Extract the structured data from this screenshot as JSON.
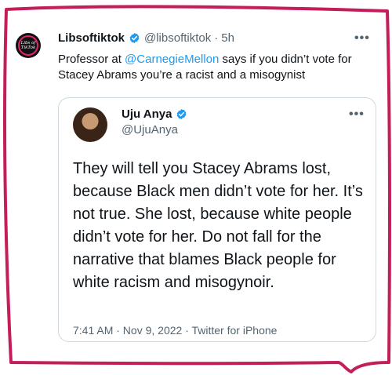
{
  "tweet": {
    "display_name": "Libsoftiktok",
    "handle": "@libsoftiktok",
    "separator": "·",
    "time": "5h",
    "more": "•••",
    "avatar_text": "Libs of TikTok",
    "text_before": "Professor at ",
    "mention": "@CarnegieMellon",
    "text_after": " says if you didn’t vote for Stacey Abrams you’re a racist and a misogynist"
  },
  "quoted": {
    "display_name": "Uju Anya",
    "handle": "@UjuAnya",
    "more": "•••",
    "text": "They will tell you Stacey Abrams lost, because Black men didn’t vote for her. It’s not true. She lost, because white people didn’t vote for her. Do not fall for the narrative that blames Black people for white racism and misogynoir.",
    "meta": "7:41 AM · Nov 9, 2022 · Twitter for iPhone"
  },
  "colors": {
    "frame": "#c41e5a",
    "link": "#1d9bf0",
    "verified": "#1d9bf0",
    "muted": "#536471"
  },
  "icons": [
    "verified-badge-icon",
    "more-options-icon"
  ]
}
